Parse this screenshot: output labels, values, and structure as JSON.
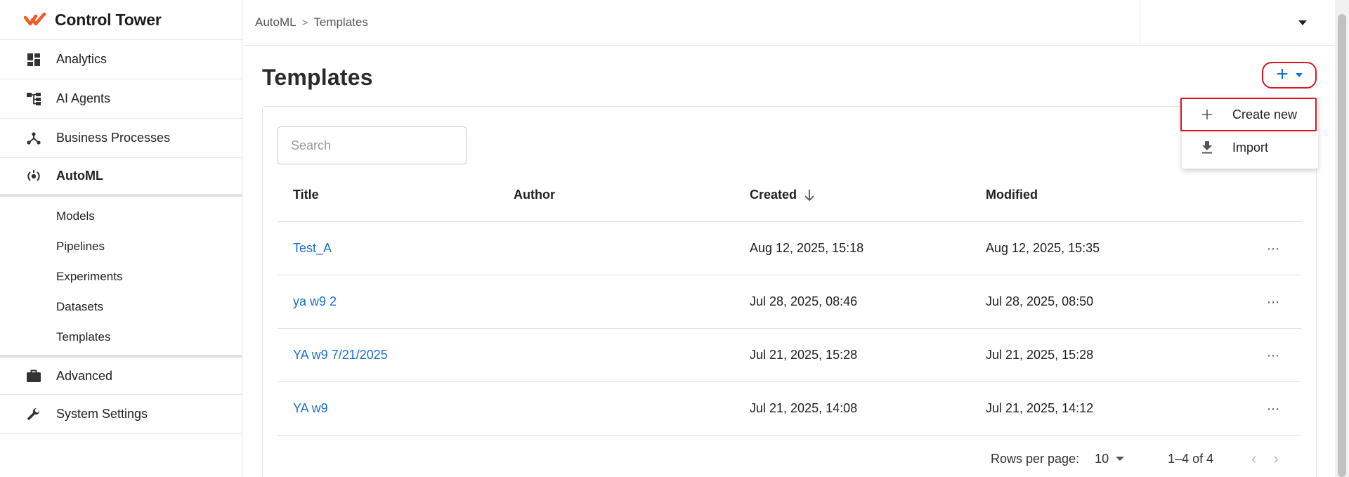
{
  "app": {
    "name": "Control Tower",
    "brand_color": "#f15a22"
  },
  "sidebar": {
    "items": [
      {
        "label": "Analytics",
        "icon": "dashboard-icon"
      },
      {
        "label": "AI Agents",
        "icon": "hierarchy-icon"
      },
      {
        "label": "Business Processes",
        "icon": "process-icon"
      },
      {
        "label": "AutoML",
        "icon": "automl-icon",
        "active": true
      }
    ],
    "sub_items": [
      "Models",
      "Pipelines",
      "Experiments",
      "Datasets",
      "Templates"
    ],
    "bottom_items": [
      {
        "label": "Advanced",
        "icon": "briefcase-icon"
      },
      {
        "label": "System Settings",
        "icon": "wrench-icon"
      }
    ]
  },
  "breadcrumb": {
    "parent": "AutoML",
    "separator": ">",
    "current": "Templates"
  },
  "page": {
    "title": "Templates",
    "add_button": "+"
  },
  "search": {
    "placeholder": "Search",
    "value": ""
  },
  "table": {
    "columns": {
      "title": "Title",
      "author": "Author",
      "created": "Created",
      "modified": "Modified"
    },
    "sort": {
      "column": "created",
      "direction": "desc"
    },
    "rows": [
      {
        "title": "Test_A",
        "author": "",
        "created": "Aug 12, 2025, 15:18",
        "modified": "Aug 12, 2025, 15:35"
      },
      {
        "title": "ya w9 2",
        "author": "",
        "created": "Jul 28, 2025, 08:46",
        "modified": "Jul 28, 2025, 08:50"
      },
      {
        "title": "YA w9 7/21/2025",
        "author": "",
        "created": "Jul 21, 2025, 15:28",
        "modified": "Jul 21, 2025, 15:28"
      },
      {
        "title": "YA w9",
        "author": "",
        "created": "Jul 21, 2025, 14:08",
        "modified": "Jul 21, 2025, 14:12"
      }
    ],
    "more_glyph": "⋯"
  },
  "pagination": {
    "rows_per_page_label": "Rows per page:",
    "rows_per_page": "10",
    "range": "1–4 of 4"
  },
  "menu": {
    "create_label": "Create new",
    "import_label": "Import"
  },
  "colors": {
    "link": "#1a6fd1",
    "highlight": "#d9161f"
  }
}
